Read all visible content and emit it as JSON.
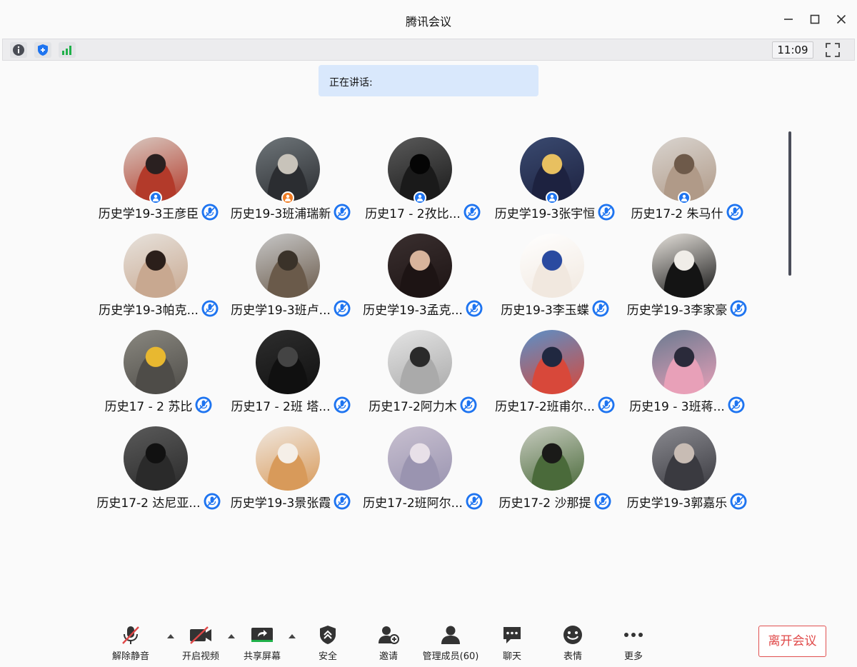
{
  "window": {
    "title": "腾讯会议"
  },
  "status": {
    "time": "11:09",
    "icons": [
      "info-icon",
      "shield-icon",
      "signal-icon"
    ]
  },
  "speaking": {
    "label": "正在讲话:"
  },
  "colors": {
    "host_badge": "#1e74f0",
    "cohost_badge": "#f07c24",
    "mic": "#1e74f0",
    "leave": "#e04848",
    "speaking_bg": "#d9e8fc"
  },
  "participants": [
    {
      "name": "历史学19-3王彦臣",
      "badge": "host",
      "avatar": [
        "#d8c8c0",
        "#b33a2a",
        "#2a2020"
      ]
    },
    {
      "name": "历史19-3班浦瑞新",
      "badge": "cohost",
      "avatar": [
        "#6f767a",
        "#2b2d31",
        "#c8c3ba"
      ]
    },
    {
      "name": "历史17 - 2孜比...",
      "badge": "host",
      "avatar": [
        "#5a5a5a",
        "#1a1a1a",
        "#050505"
      ]
    },
    {
      "name": "历史学19-3张宇恒",
      "badge": "host",
      "avatar": [
        "#3a4a70",
        "#1d2240",
        "#e8c060"
      ]
    },
    {
      "name": "历史17-2 朱马什",
      "badge": "host",
      "avatar": [
        "#d9d4cf",
        "#b09a88",
        "#6e5a4a"
      ]
    },
    {
      "name": "历史学19-3帕克...",
      "badge": "",
      "avatar": [
        "#e7e2dc",
        "#c8a890",
        "#2b1f1a"
      ]
    },
    {
      "name": "历史学19-3班卢...",
      "badge": "",
      "avatar": [
        "#c7c7c7",
        "#6a5a4a",
        "#3a3229"
      ]
    },
    {
      "name": "历史学19-3孟克...",
      "badge": "",
      "avatar": [
        "#3a2f2f",
        "#1d1414",
        "#d8b49c"
      ]
    },
    {
      "name": "历史19-3李玉蝶",
      "badge": "",
      "avatar": [
        "#ffffff",
        "#f1e8df",
        "#2a4aa0"
      ]
    },
    {
      "name": "历史学19-3李家豪",
      "badge": "",
      "avatar": [
        "#e6e2dc",
        "#141414",
        "#f0ede8"
      ]
    },
    {
      "name": "历史17 - 2 苏比",
      "badge": "",
      "avatar": [
        "#8a8880",
        "#4e4c48",
        "#e8b830"
      ]
    },
    {
      "name": "历史17 - 2班 塔...",
      "badge": "",
      "avatar": [
        "#2e2e2e",
        "#101010",
        "#444444"
      ]
    },
    {
      "name": "历史17-2阿力木",
      "badge": "",
      "avatar": [
        "#e4e4e4",
        "#aaaaaa",
        "#2a2a2a"
      ]
    },
    {
      "name": "历史17-2班甫尔...",
      "badge": "",
      "avatar": [
        "#5a90c8",
        "#d8483a",
        "#202840"
      ]
    },
    {
      "name": "历史19 - 3班蒋...",
      "badge": "",
      "avatar": [
        "#6a7a90",
        "#e8a0b8",
        "#2a2a3a"
      ]
    },
    {
      "name": "历史17-2 达尼亚...",
      "badge": "",
      "avatar": [
        "#5a5a5a",
        "#2a2a2a",
        "#111111"
      ]
    },
    {
      "name": "历史学19-3景张霞",
      "badge": "",
      "avatar": [
        "#f0e8e0",
        "#d89a5a",
        "#f5efe8"
      ]
    },
    {
      "name": "历史17-2班阿尔...",
      "badge": "",
      "avatar": [
        "#c8c0d0",
        "#9a94b0",
        "#e8e0e8"
      ]
    },
    {
      "name": "历史17-2  沙那提",
      "badge": "",
      "avatar": [
        "#c8ccc0",
        "#4a6a3a",
        "#1a1a18"
      ]
    },
    {
      "name": "历史学19-3郭嘉乐",
      "badge": "",
      "avatar": [
        "#8a8a90",
        "#3a3a40",
        "#c8bcb4"
      ]
    }
  ],
  "toolbar": {
    "mute": "解除静音",
    "video": "开启视频",
    "share": "共享屏幕",
    "security": "安全",
    "invite": "邀请",
    "members": "管理成员(60)",
    "chat": "聊天",
    "emoji": "表情",
    "more": "更多",
    "leave": "离开会议"
  }
}
